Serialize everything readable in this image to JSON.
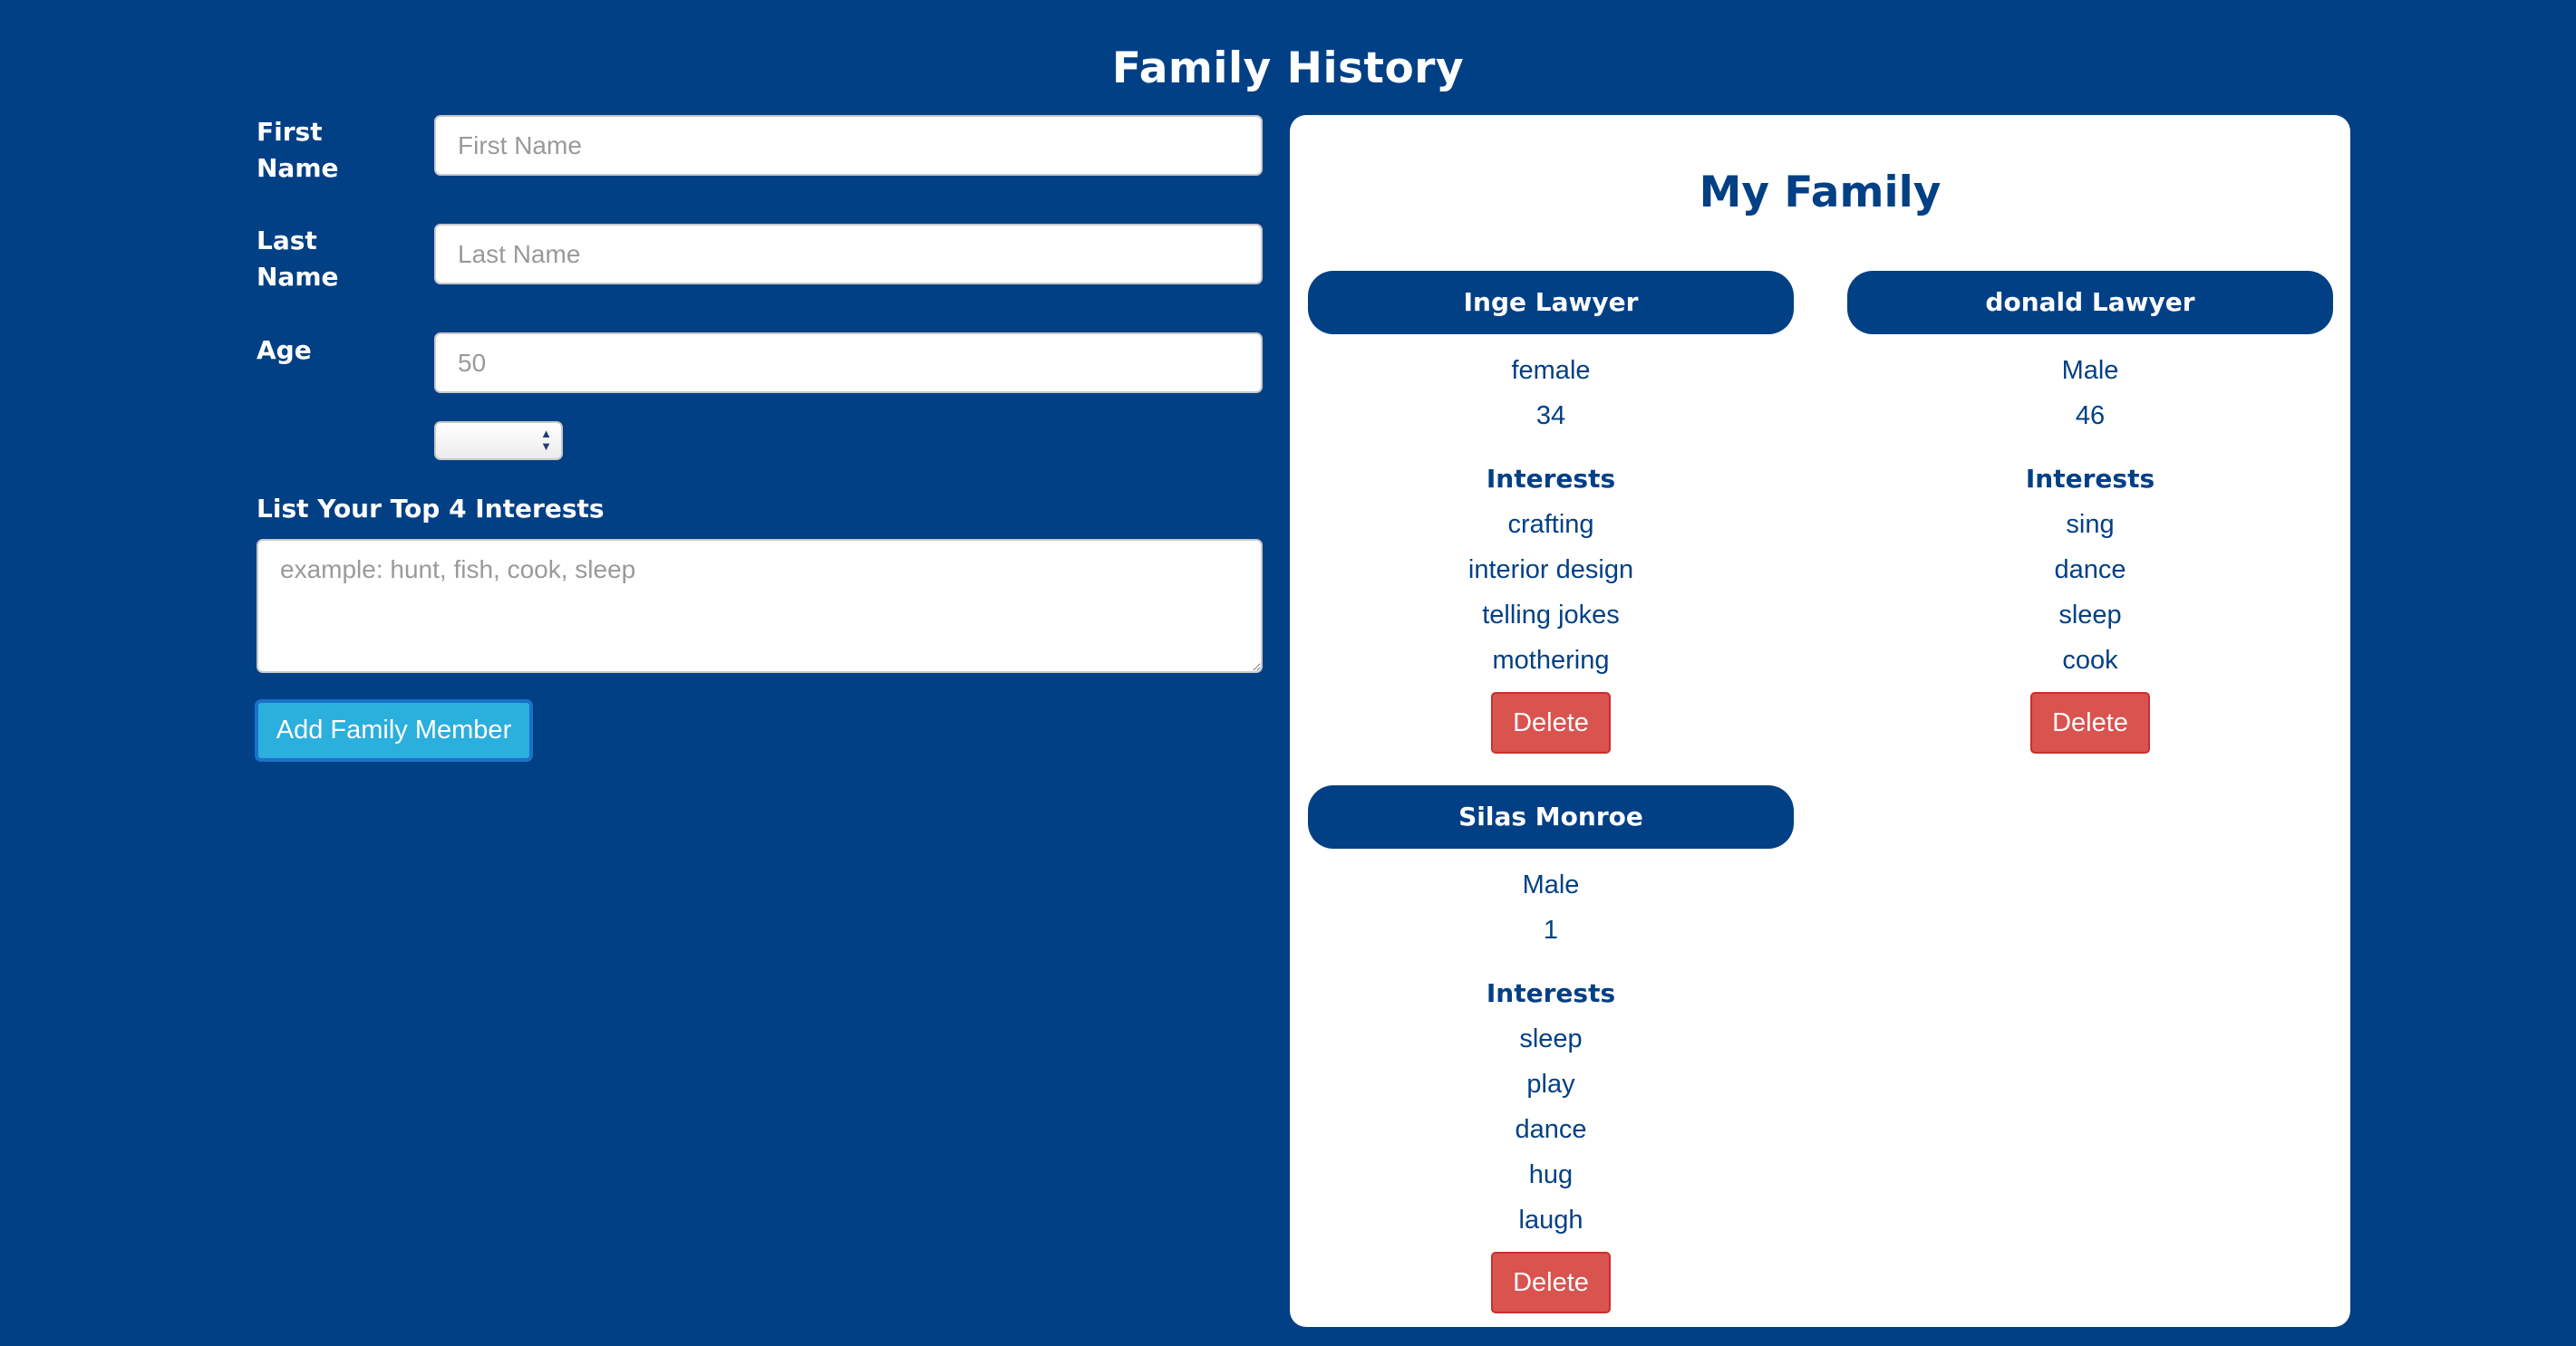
{
  "page": {
    "title": "Family History"
  },
  "form": {
    "first_name": {
      "label_line1": "First",
      "label_line2": "Name",
      "placeholder": "First Name",
      "value": ""
    },
    "last_name": {
      "label_line1": "Last",
      "label_line2": "Name",
      "placeholder": "Last Name",
      "value": ""
    },
    "age": {
      "label": "Age",
      "placeholder": "50",
      "value": ""
    },
    "gender_select": {
      "selected": ""
    },
    "interests": {
      "label": "List Your Top 4 Interests",
      "placeholder": "example: hunt, fish, cook, sleep",
      "value": ""
    },
    "add_button_label": "Add Family Member"
  },
  "family": {
    "title": "My Family",
    "interests_heading": "Interests",
    "delete_label": "Delete",
    "members": [
      {
        "name": "Inge Lawyer",
        "gender": "female",
        "age": "34",
        "interests": [
          "crafting",
          "interior design",
          "telling jokes",
          "mothering"
        ]
      },
      {
        "name": "donald Lawyer",
        "gender": "Male",
        "age": "46",
        "interests": [
          "sing",
          "dance",
          "sleep",
          "cook"
        ]
      },
      {
        "name": "Silas Monroe",
        "gender": "Male",
        "age": "1",
        "interests": [
          "sleep",
          "play",
          "dance",
          "hug",
          "laugh"
        ]
      }
    ]
  },
  "colors": {
    "background": "#024085",
    "accent_button": "#2bafdd",
    "delete_button": "#d9534f"
  }
}
